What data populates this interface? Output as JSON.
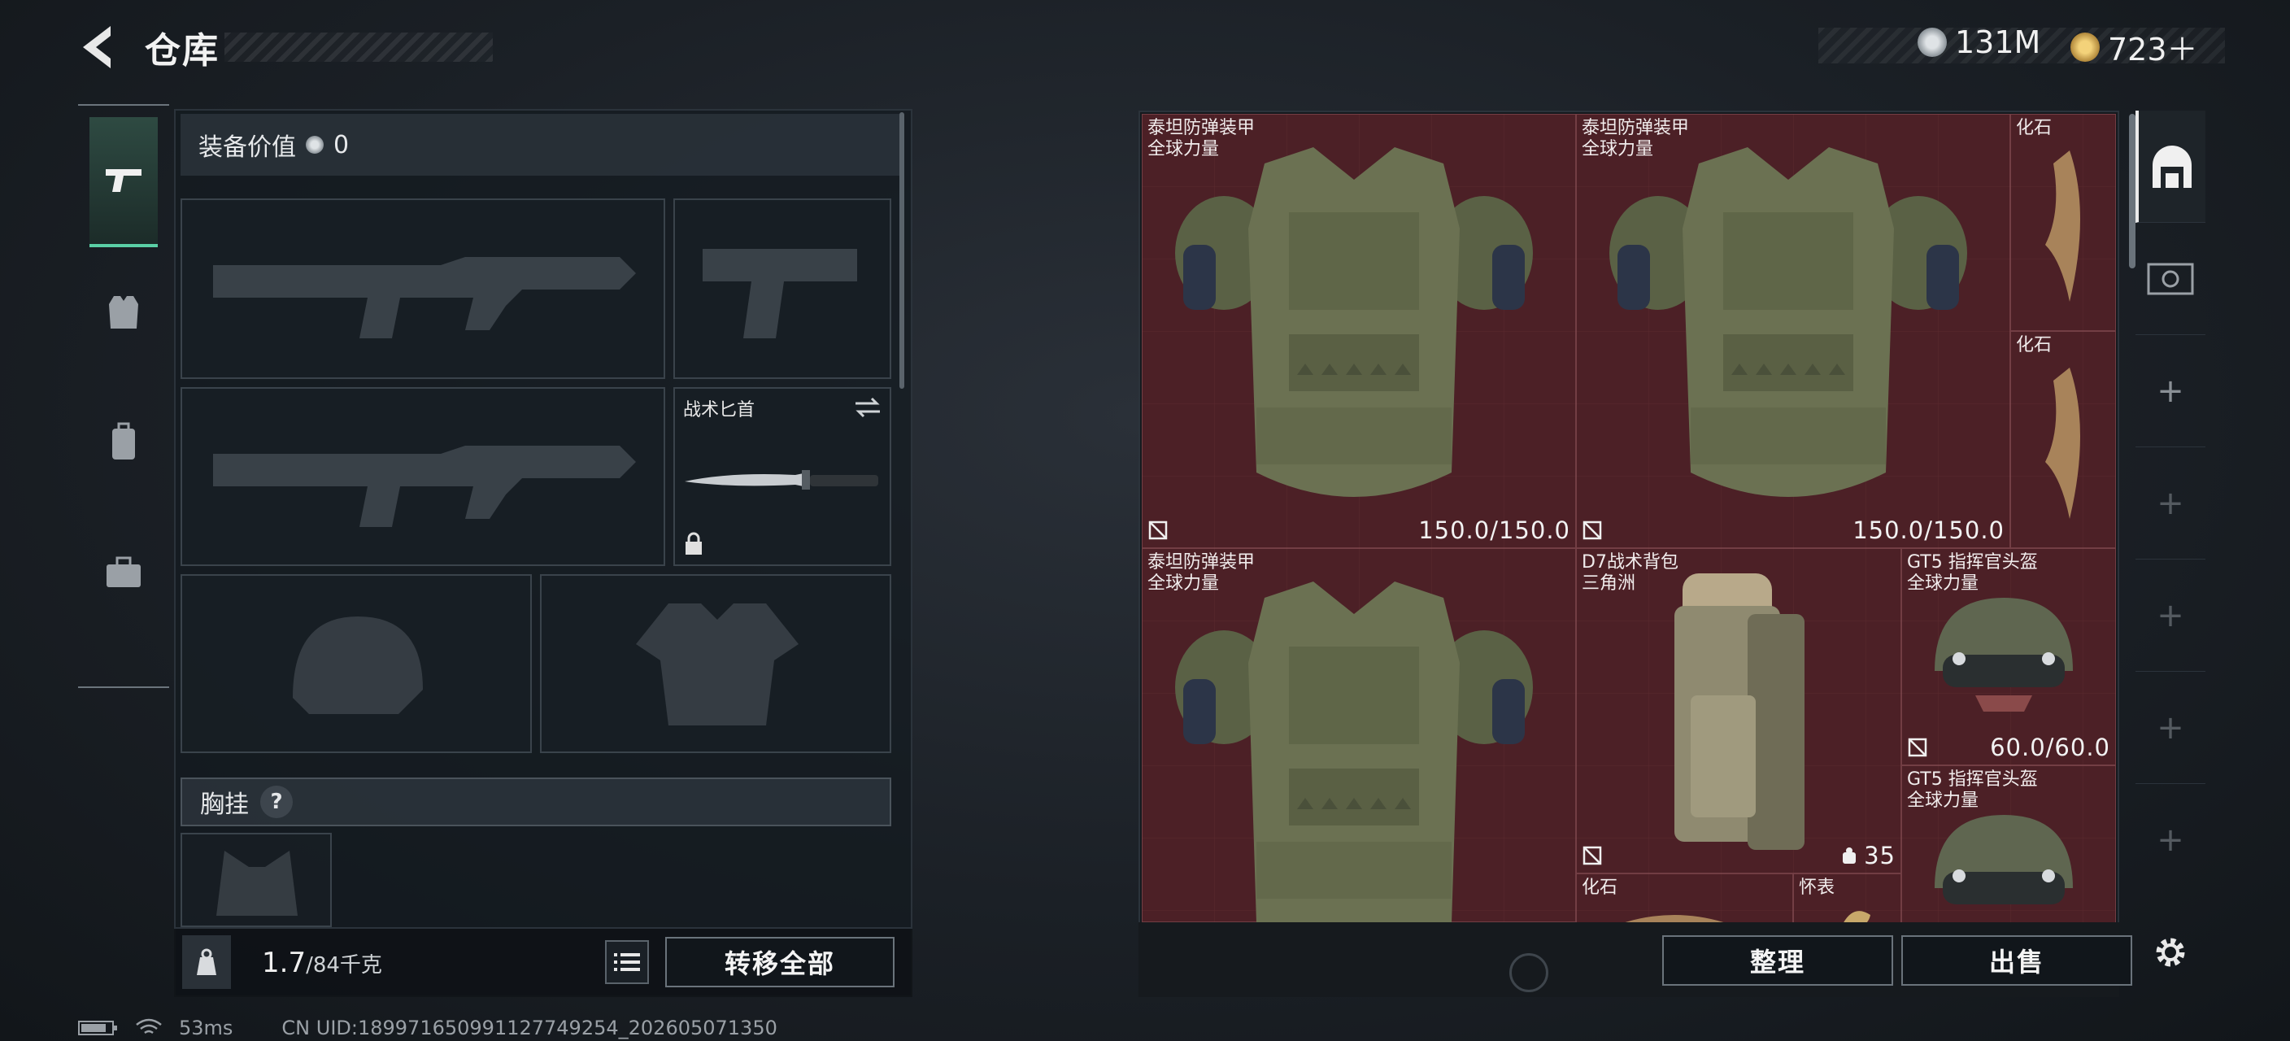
{
  "header": {
    "title": "仓库",
    "currency_1": "131M",
    "currency_2": "723＋"
  },
  "left_panel": {
    "equip_value_label": "装备价值",
    "equip_value": "0",
    "knife_slot_label": "战术匕首",
    "chest_label": "胸挂",
    "chest_help": "?",
    "weight_current": "1.7",
    "weight_max": "/84千克",
    "transfer_all_button": "转移全部"
  },
  "storage": {
    "items": [
      {
        "name": "泰坦防弹装甲",
        "sub": "全球力量",
        "durability": "150.0/150.0"
      },
      {
        "name": "泰坦防弹装甲",
        "sub": "全球力量",
        "durability": "150.0/150.0"
      },
      {
        "name": "化石",
        "sub": ""
      },
      {
        "name": "化石",
        "sub": ""
      },
      {
        "name": "泰坦防弹装甲",
        "sub": "全球力量",
        "durability": ""
      },
      {
        "name": "D7战术背包",
        "sub": "三角洲",
        "count": "35"
      },
      {
        "name": "GT5 指挥官头盔",
        "sub": "全球力量",
        "durability": "60.0/60.0"
      },
      {
        "name": "GT5 指挥官头盔",
        "sub": "全球力量"
      },
      {
        "name": "化石",
        "sub": ""
      },
      {
        "name": "怀表",
        "sub": ""
      }
    ],
    "sort_button": "整理",
    "sell_button": "出售"
  },
  "status_bar": {
    "ping": "53ms",
    "uid": "CN UID:18997165099112774925​4_202605071350"
  },
  "colors": {
    "accent": "#5ad0a6",
    "grid_bg": "#4a2126"
  }
}
